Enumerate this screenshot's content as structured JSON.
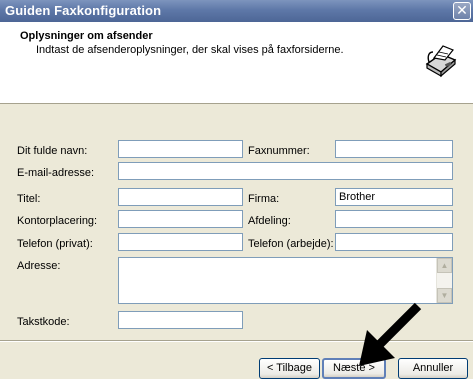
{
  "window": {
    "title": "Guiden Faxkonfiguration",
    "close_glyph": "✕"
  },
  "header": {
    "title": "Oplysninger om afsender",
    "subtitle": "Indtast de afsenderoplysninger, der skal vises på faxforsiderne.",
    "icon": "fax-machine-icon"
  },
  "form": {
    "full_name": {
      "label": "Dit fulde navn:",
      "value": ""
    },
    "fax_number": {
      "label": "Faxnummer:",
      "value": ""
    },
    "email": {
      "label": "E-mail-adresse:",
      "value": ""
    },
    "title": {
      "label": "Titel:",
      "value": ""
    },
    "company": {
      "label": "Firma:",
      "value": "Brother"
    },
    "office": {
      "label": "Kontorplacering:",
      "value": ""
    },
    "department": {
      "label": "Afdeling:",
      "value": ""
    },
    "phone_private": {
      "label": "Telefon (privat):",
      "value": ""
    },
    "phone_work": {
      "label": "Telefon (arbejde):",
      "value": ""
    },
    "address": {
      "label": "Adresse:",
      "value": ""
    },
    "key_code": {
      "label": "Takstkode:",
      "value": ""
    }
  },
  "buttons": {
    "back": "< Tilbage",
    "next": "Næste >",
    "cancel": "Annuller"
  },
  "annotation": {
    "icon": "pointer-arrow-icon",
    "color": "#000000"
  }
}
